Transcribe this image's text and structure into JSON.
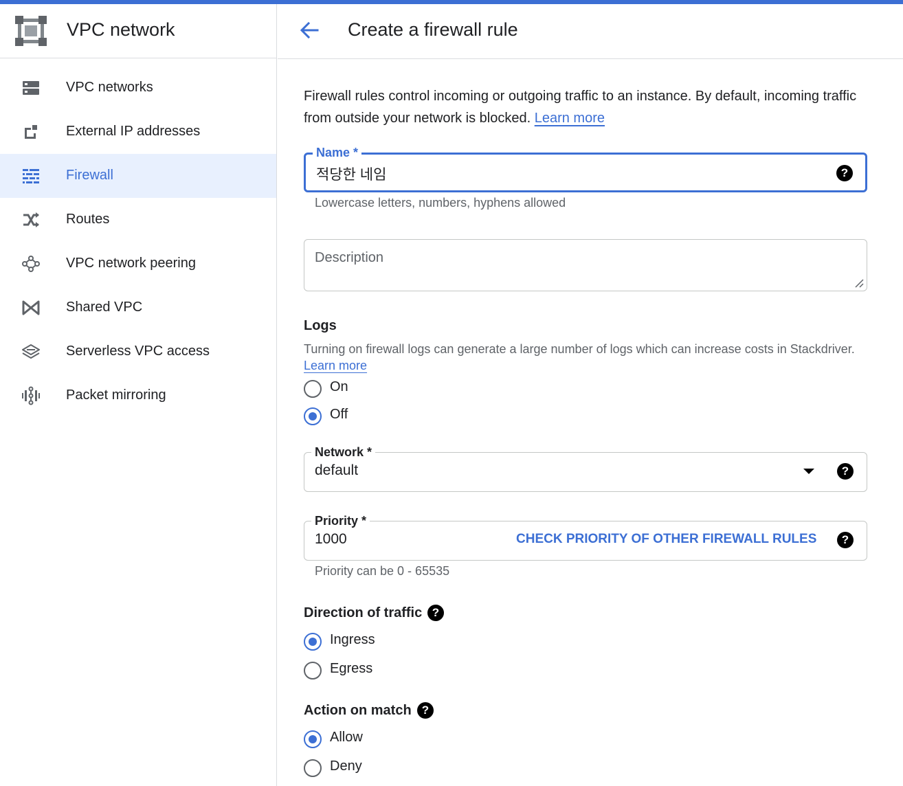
{
  "sidebar": {
    "title": "VPC network",
    "items": [
      {
        "label": "VPC networks",
        "icon": "vpc-networks-icon"
      },
      {
        "label": "External IP addresses",
        "icon": "external-ip-icon"
      },
      {
        "label": "Firewall",
        "icon": "firewall-icon",
        "active": true
      },
      {
        "label": "Routes",
        "icon": "routes-icon"
      },
      {
        "label": "VPC network peering",
        "icon": "peering-icon"
      },
      {
        "label": "Shared VPC",
        "icon": "shared-vpc-icon"
      },
      {
        "label": "Serverless VPC access",
        "icon": "serverless-icon"
      },
      {
        "label": "Packet mirroring",
        "icon": "packet-mirroring-icon"
      }
    ]
  },
  "header": {
    "title": "Create a firewall rule"
  },
  "intro": {
    "text": "Firewall rules control incoming or outgoing traffic to an instance. By default, incoming traffic from outside your network is blocked.",
    "link": "Learn more"
  },
  "name_field": {
    "label": "Name *",
    "value": "적당한 네임",
    "hint": "Lowercase letters, numbers, hyphens allowed",
    "help": "?"
  },
  "description_field": {
    "placeholder": "Description"
  },
  "logs": {
    "title": "Logs",
    "desc": "Turning on firewall logs can generate a large number of logs which can increase costs in Stackdriver.",
    "link": "Learn more",
    "options": [
      {
        "label": "On",
        "checked": false
      },
      {
        "label": "Off",
        "checked": true
      }
    ]
  },
  "network_field": {
    "label": "Network *",
    "value": "default",
    "help": "?"
  },
  "priority_field": {
    "label": "Priority *",
    "value": "1000",
    "action": "CHECK PRIORITY OF OTHER FIREWALL RULES",
    "hint": "Priority can be 0 - 65535",
    "help": "?"
  },
  "direction": {
    "title": "Direction of traffic",
    "help": "?",
    "options": [
      {
        "label": "Ingress",
        "checked": true
      },
      {
        "label": "Egress",
        "checked": false
      }
    ]
  },
  "action": {
    "title": "Action on match",
    "help": "?",
    "options": [
      {
        "label": "Allow",
        "checked": true
      },
      {
        "label": "Deny",
        "checked": false
      }
    ]
  },
  "colors": {
    "accent": "#3c6fd4",
    "text": "#202124",
    "secondary": "#5f6368",
    "active_bg": "#e8f0fe"
  }
}
